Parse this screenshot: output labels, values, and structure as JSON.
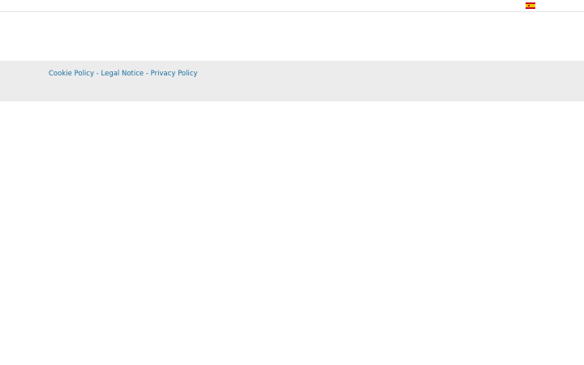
{
  "header": {
    "language_flag_icon": "spain-flag-icon",
    "flag_colors": {
      "red": "#c60b1e",
      "yellow": "#ffc400"
    }
  },
  "footer": {
    "links": [
      {
        "label": "Cookie Policy"
      },
      {
        "label": "Legal Notice"
      },
      {
        "label": "Privacy Policy"
      }
    ],
    "separator": "-",
    "link_color": "#1a6ea0",
    "background": "#ececec"
  }
}
